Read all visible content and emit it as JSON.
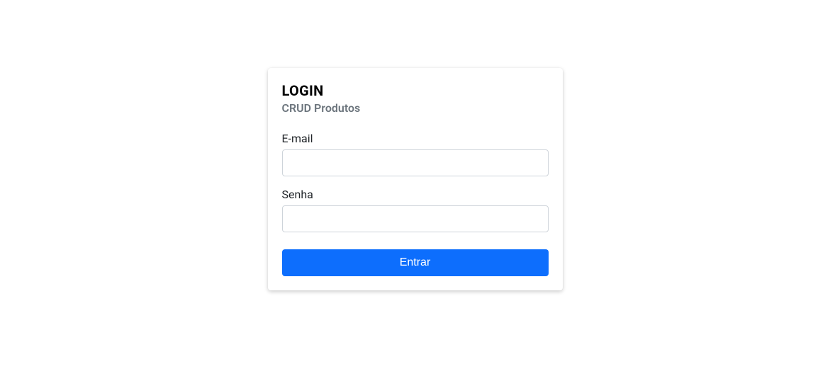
{
  "header": {
    "title": "LOGIN",
    "subtitle": "CRUD Produtos"
  },
  "form": {
    "email": {
      "label": "E-mail",
      "value": ""
    },
    "password": {
      "label": "Senha",
      "value": ""
    },
    "submit_label": "Entrar"
  }
}
